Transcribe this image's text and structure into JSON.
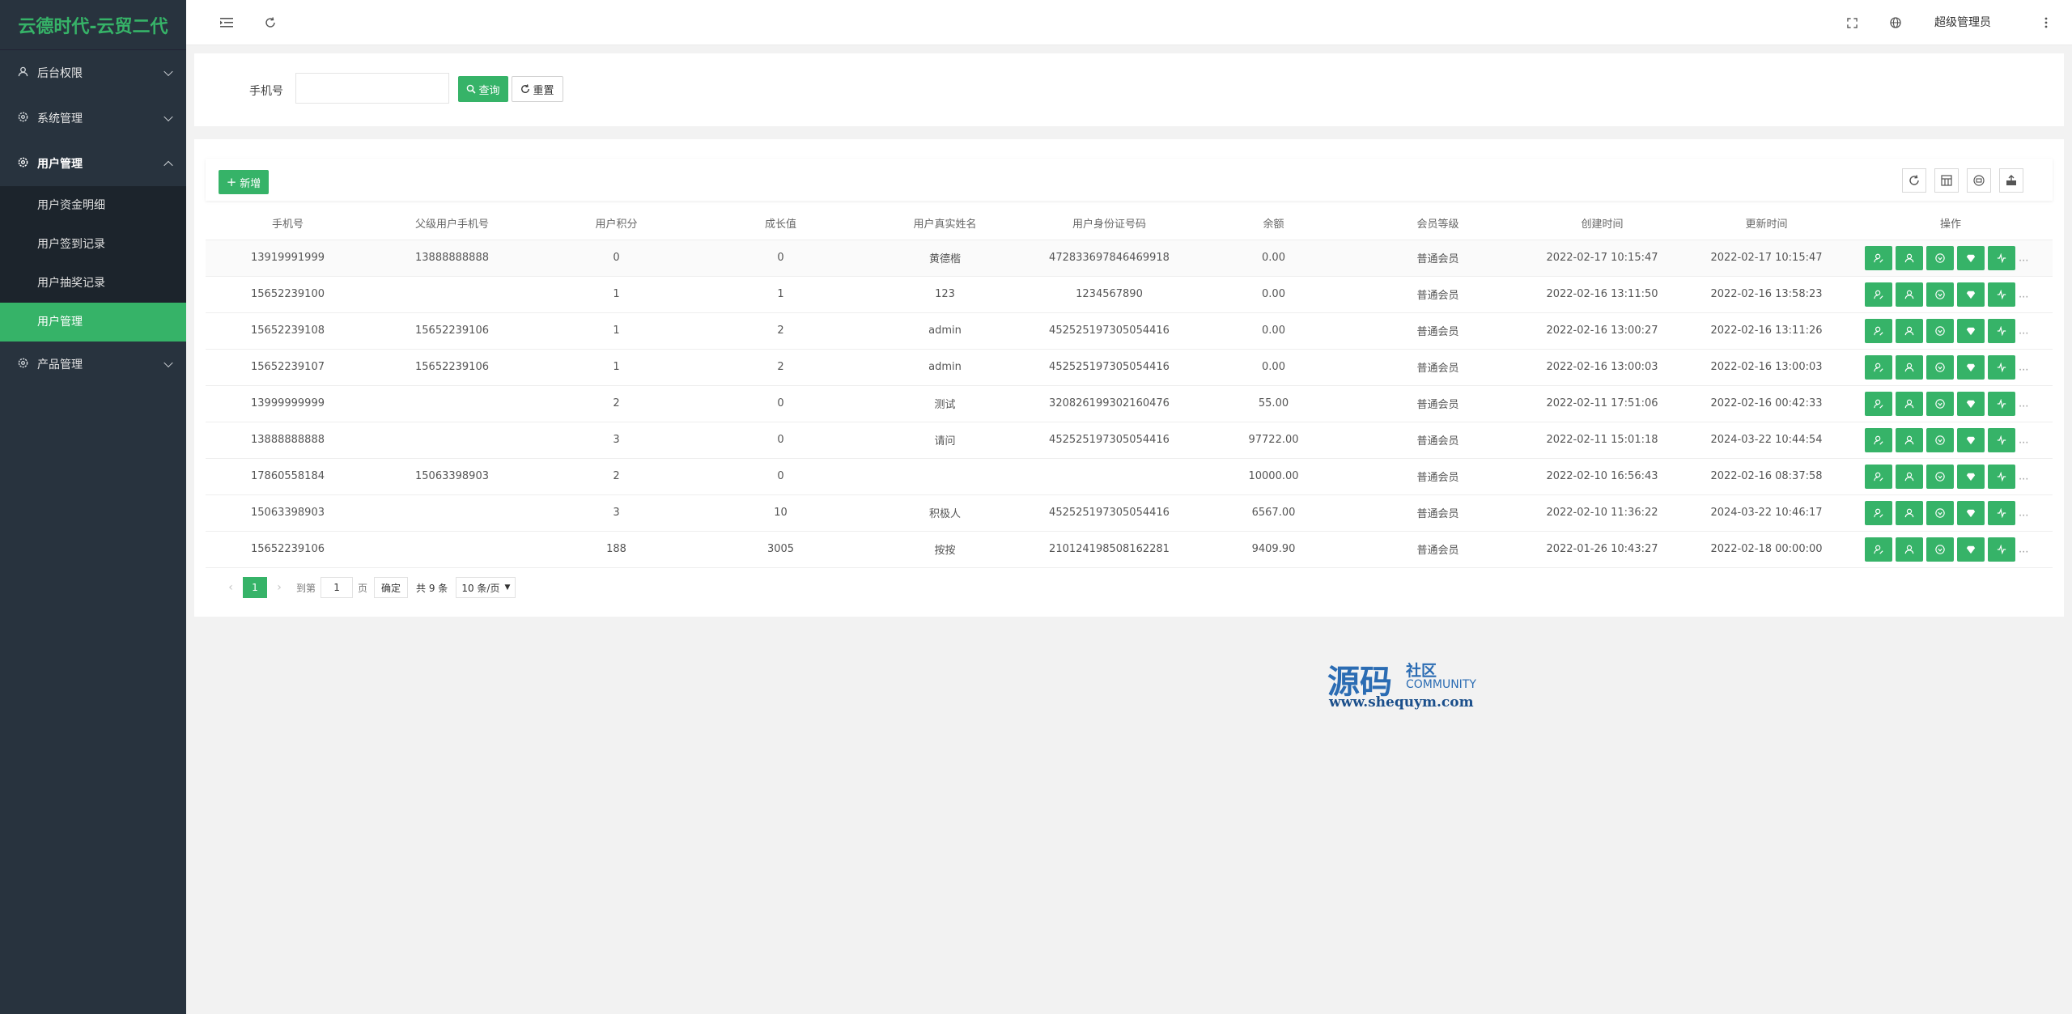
{
  "app": {
    "title": "云德时代-云贸二代"
  },
  "sidebar": {
    "groups": [
      {
        "label": "后台权限",
        "icon": "user-icon"
      },
      {
        "label": "系统管理",
        "icon": "gear-icon"
      },
      {
        "label": "用户管理",
        "icon": "gear-icon"
      },
      {
        "label": "产品管理",
        "icon": "gear-icon"
      }
    ],
    "sub_items": [
      "用户资金明细",
      "用户签到记录",
      "用户抽奖记录",
      "用户管理"
    ],
    "active_sub": "用户管理"
  },
  "header": {
    "user_name": "超级管理员"
  },
  "search": {
    "phone_label": "手机号",
    "phone_value": "",
    "query_label": "查询",
    "reset_label": "重置"
  },
  "toolbar": {
    "add_label": "新增"
  },
  "table": {
    "columns": [
      "手机号",
      "父级用户手机号",
      "用户积分",
      "成长值",
      "用户真实姓名",
      "用户身份证号码",
      "余额",
      "会员等级",
      "创建时间",
      "更新时间",
      "操作"
    ],
    "rows": [
      [
        "13919991999",
        "13888888888",
        "0",
        "0",
        "黄德楷",
        "472833697846469918",
        "0.00",
        "普通会员",
        "2022-02-17 10:15:47",
        "2022-02-17 10:15:47"
      ],
      [
        "15652239100",
        "",
        "1",
        "1",
        "123",
        "1234567890",
        "0.00",
        "普通会员",
        "2022-02-16 13:11:50",
        "2022-02-16 13:58:23"
      ],
      [
        "15652239108",
        "15652239106",
        "1",
        "2",
        "admin",
        "452525197305054416",
        "0.00",
        "普通会员",
        "2022-02-16 13:00:27",
        "2022-02-16 13:11:26"
      ],
      [
        "15652239107",
        "15652239106",
        "1",
        "2",
        "admin",
        "452525197305054416",
        "0.00",
        "普通会员",
        "2022-02-16 13:00:03",
        "2022-02-16 13:00:03"
      ],
      [
        "13999999999",
        "",
        "2",
        "0",
        "测试",
        "320826199302160476",
        "55.00",
        "普通会员",
        "2022-02-11 17:51:06",
        "2022-02-16 00:42:33"
      ],
      [
        "13888888888",
        "",
        "3",
        "0",
        "请问",
        "452525197305054416",
        "97722.00",
        "普通会员",
        "2022-02-11 15:01:18",
        "2024-03-22 10:44:54"
      ],
      [
        "17860558184",
        "15063398903",
        "2",
        "0",
        "",
        "",
        "10000.00",
        "普通会员",
        "2022-02-10 16:56:43",
        "2022-02-16 08:37:58"
      ],
      [
        "15063398903",
        "",
        "3",
        "10",
        "积极人",
        "452525197305054416",
        "6567.00",
        "普通会员",
        "2022-02-10 11:36:22",
        "2024-03-22 10:46:17"
      ],
      [
        "15652239106",
        "",
        "188",
        "3005",
        "按按",
        "210124198508162281",
        "9409.90",
        "普通会员",
        "2022-01-26 10:43:27",
        "2022-02-18 00:00:00"
      ]
    ],
    "row_action_icons": [
      "user-edit-icon",
      "user-icon",
      "shield-icon",
      "diamond-icon",
      "activity-icon"
    ],
    "more_label": "..."
  },
  "pager": {
    "current": "1",
    "goto_label": "到第",
    "goto_value": "1",
    "page_label": "页",
    "ok_label": "确定",
    "total_label": "共 9 条",
    "size_label": "10 条/页"
  },
  "watermark": {
    "big": "源码",
    "small": "社区",
    "community": "COMMUNITY",
    "url": "www.shequym.com"
  },
  "colors": {
    "accent": "#36b368",
    "sidebar": "#28333e",
    "sidebar_sub": "#1c242c"
  }
}
